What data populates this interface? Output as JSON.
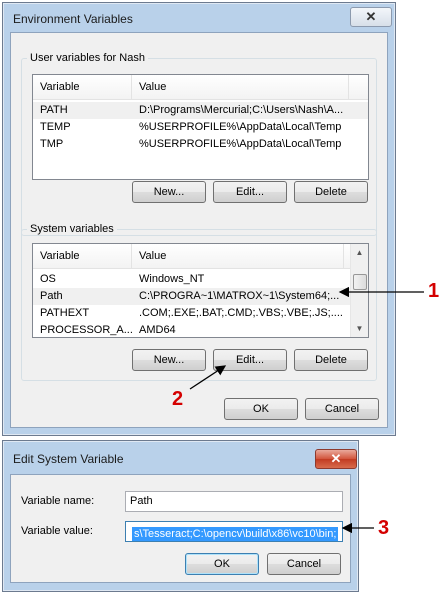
{
  "env_dialog": {
    "title": "Environment Variables",
    "close_glyph": "✕",
    "user_group": {
      "label": "User variables for Nash",
      "headers": [
        "Variable",
        "Value"
      ],
      "rows": [
        {
          "variable": "PATH",
          "value": "D:\\Programs\\Mercurial;C:\\Users\\Nash\\A..."
        },
        {
          "variable": "TEMP",
          "value": "%USERPROFILE%\\AppData\\Local\\Temp"
        },
        {
          "variable": "TMP",
          "value": "%USERPROFILE%\\AppData\\Local\\Temp"
        }
      ],
      "new_label": "New...",
      "edit_label": "Edit...",
      "delete_label": "Delete"
    },
    "system_group": {
      "label": "System variables",
      "headers": [
        "Variable",
        "Value"
      ],
      "rows": [
        {
          "variable": "OS",
          "value": "Windows_NT"
        },
        {
          "variable": "Path",
          "value": "C:\\PROGRA~1\\MATROX~1\\System64;..."
        },
        {
          "variable": "PATHEXT",
          "value": ".COM;.EXE;.BAT;.CMD;.VBS;.VBE;.JS;...."
        },
        {
          "variable": "PROCESSOR_A...",
          "value": "AMD64"
        }
      ],
      "new_label": "New...",
      "edit_label": "Edit...",
      "delete_label": "Delete"
    },
    "ok_label": "OK",
    "cancel_label": "Cancel"
  },
  "edit_dialog": {
    "title": "Edit System Variable",
    "close_glyph": "✕",
    "name_label": "Variable name:",
    "name_value": "Path",
    "value_label": "Variable value:",
    "value_value": "s\\Tesseract;C:\\opencv\\build\\x86\\vc10\\bin;",
    "ok_label": "OK",
    "cancel_label": "Cancel"
  },
  "annotations": {
    "callout_1": "1",
    "callout_2": "2",
    "callout_3": "3",
    "color": "#d40000"
  }
}
